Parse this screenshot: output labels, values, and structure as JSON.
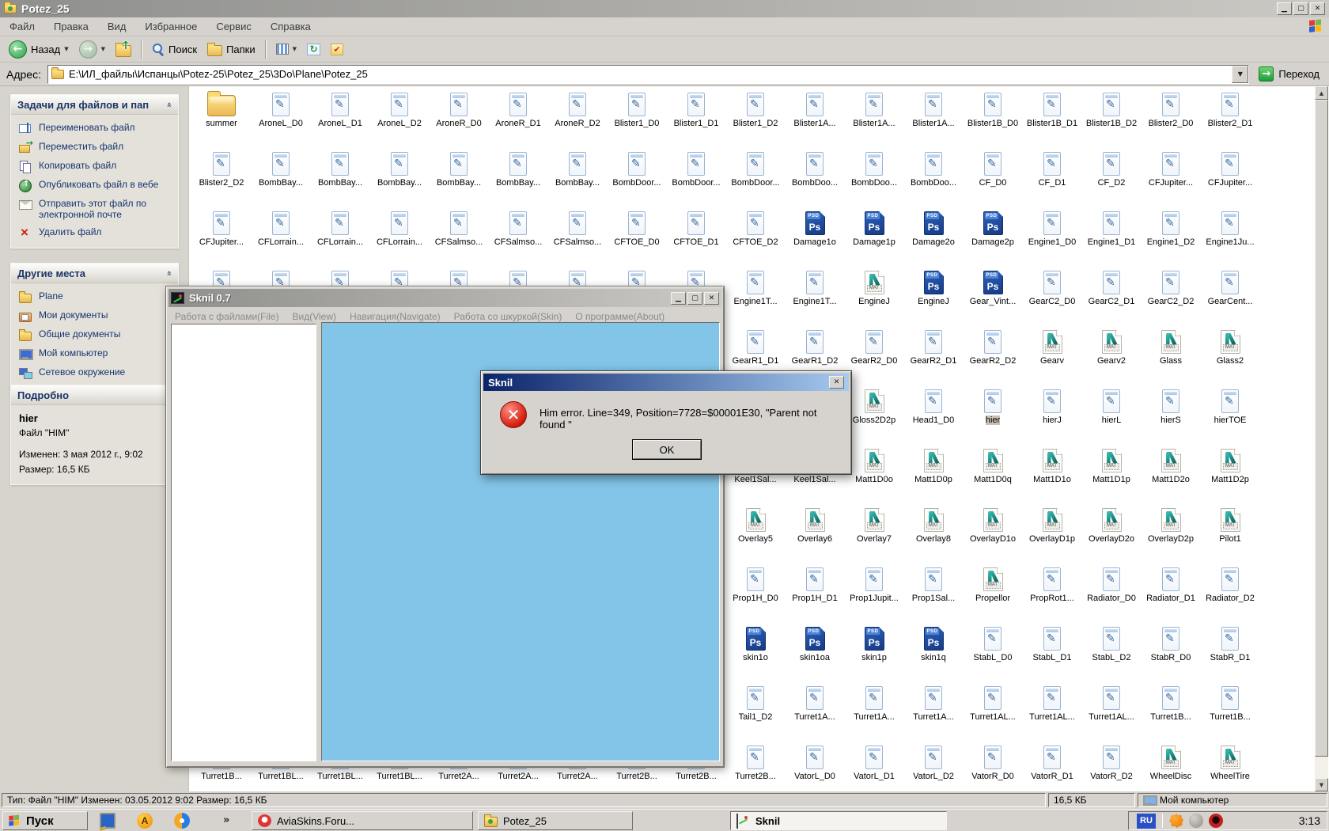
{
  "colors": {
    "classic_face": "#d6d3ce",
    "canvas_blue": "#83c5e9",
    "title_active_left": "#0a246a",
    "title_active_right": "#a6caf0",
    "title_inactive_left": "#8f8f8d",
    "title_inactive_right": "#cbc9c4",
    "selection_unfocused": "#c9c2b4",
    "error_red": "#d11c0c"
  },
  "explorer": {
    "title": "Potez_25",
    "menu": [
      "Файл",
      "Правка",
      "Вид",
      "Избранное",
      "Сервис",
      "Справка"
    ],
    "toolbar": {
      "back_label": "Назад",
      "search_label": "Поиск",
      "folders_label": "Папки"
    },
    "address_label": "Адрес:",
    "address_value": "E:\\ИЛ_файлы\\Испанцы\\Potez-25\\Potez_25\\3Do\\Plane\\Potez_25",
    "go_label": "Переход",
    "tasks_panel": {
      "title": "Задачи для файлов и пап",
      "items": [
        {
          "icon": "rename-icon",
          "label": "Переименовать файл"
        },
        {
          "icon": "move-icon",
          "label": "Переместить файл"
        },
        {
          "icon": "copy-icon",
          "label": "Копировать файл"
        },
        {
          "icon": "publish-icon",
          "label": "Опубликовать файл в вебе"
        },
        {
          "icon": "email-icon",
          "label": "Отправить этот файл по электронной почте"
        },
        {
          "icon": "delete-icon",
          "label": "Удалить файл"
        }
      ]
    },
    "places_panel": {
      "title": "Другие места",
      "items": [
        {
          "icon": "folder-icon-s",
          "label": "Plane"
        },
        {
          "icon": "my-documents-icon",
          "label": "Мои документы"
        },
        {
          "icon": "folder-icon-s",
          "label": "Общие документы"
        },
        {
          "icon": "my-computer-icon",
          "label": "Мой компьютер"
        },
        {
          "icon": "network-icon",
          "label": "Сетевое окружение"
        }
      ]
    },
    "details_panel": {
      "title": "Подробно",
      "name": "hier",
      "type_line": "Файл \"HIM\"",
      "modified_line": "Изменен: 3 мая 2012 г., 9:02",
      "size_line": "Размер: 16,5 КБ"
    },
    "status_left": "Тип: Файл \"HIM\" Изменен: 03.05.2012 9:02 Размер: 16,5 КБ",
    "status_size": "16,5 КБ",
    "status_zone": "Мой компьютер"
  },
  "files": [
    {
      "row": 1,
      "col": 1,
      "type": "folder",
      "label": "summer"
    },
    {
      "row": 1,
      "col": 2,
      "type": "doc",
      "label": "AroneL_D0"
    },
    {
      "row": 1,
      "col": 3,
      "type": "doc",
      "label": "AroneL_D1"
    },
    {
      "row": 1,
      "col": 4,
      "type": "doc",
      "label": "AroneL_D2"
    },
    {
      "row": 1,
      "col": 5,
      "type": "doc",
      "label": "AroneR_D0"
    },
    {
      "row": 1,
      "col": 6,
      "type": "doc",
      "label": "AroneR_D1"
    },
    {
      "row": 1,
      "col": 7,
      "type": "doc",
      "label": "AroneR_D2"
    },
    {
      "row": 1,
      "col": 8,
      "type": "doc",
      "label": "Blister1_D0"
    },
    {
      "row": 1,
      "col": 9,
      "type": "doc",
      "label": "Blister1_D1"
    },
    {
      "row": 1,
      "col": 10,
      "type": "doc",
      "label": "Blister1_D2"
    },
    {
      "row": 1,
      "col": 11,
      "type": "doc",
      "label": "Blister1A..."
    },
    {
      "row": 1,
      "col": 12,
      "type": "doc",
      "label": "Blister1A..."
    },
    {
      "row": 1,
      "col": 13,
      "type": "doc",
      "label": "Blister1A..."
    },
    {
      "row": 1,
      "col": 14,
      "type": "doc",
      "label": "Blister1B_D0"
    },
    {
      "row": 1,
      "col": 15,
      "type": "doc",
      "label": "Blister1B_D1"
    },
    {
      "row": 1,
      "col": 16,
      "type": "doc",
      "label": "Blister1B_D2"
    },
    {
      "row": 1,
      "col": 17,
      "type": "doc",
      "label": "Blister2_D0"
    },
    {
      "row": 1,
      "col": 18,
      "type": "doc",
      "label": "Blister2_D1"
    },
    {
      "row": 2,
      "col": 1,
      "type": "doc",
      "label": "Blister2_D2"
    },
    {
      "row": 2,
      "col": 2,
      "type": "doc",
      "label": "BombBay..."
    },
    {
      "row": 2,
      "col": 3,
      "type": "doc",
      "label": "BombBay..."
    },
    {
      "row": 2,
      "col": 4,
      "type": "doc",
      "label": "BombBay..."
    },
    {
      "row": 2,
      "col": 5,
      "type": "doc",
      "label": "BombBay..."
    },
    {
      "row": 2,
      "col": 6,
      "type": "doc",
      "label": "BombBay..."
    },
    {
      "row": 2,
      "col": 7,
      "type": "doc",
      "label": "BombBay..."
    },
    {
      "row": 2,
      "col": 8,
      "type": "doc",
      "label": "BombDoor..."
    },
    {
      "row": 2,
      "col": 9,
      "type": "doc",
      "label": "BombDoor..."
    },
    {
      "row": 2,
      "col": 10,
      "type": "doc",
      "label": "BombDoor..."
    },
    {
      "row": 2,
      "col": 11,
      "type": "doc",
      "label": "BombDoo..."
    },
    {
      "row": 2,
      "col": 12,
      "type": "doc",
      "label": "BombDoo..."
    },
    {
      "row": 2,
      "col": 13,
      "type": "doc",
      "label": "BombDoo..."
    },
    {
      "row": 2,
      "col": 14,
      "type": "doc",
      "label": "CF_D0"
    },
    {
      "row": 2,
      "col": 15,
      "type": "doc",
      "label": "CF_D1"
    },
    {
      "row": 2,
      "col": 16,
      "type": "doc",
      "label": "CF_D2"
    },
    {
      "row": 2,
      "col": 17,
      "type": "doc",
      "label": "CFJupiter..."
    },
    {
      "row": 2,
      "col": 18,
      "type": "doc",
      "label": "CFJupiter..."
    },
    {
      "row": 3,
      "col": 1,
      "type": "doc",
      "label": "CFJupiter..."
    },
    {
      "row": 3,
      "col": 2,
      "type": "doc",
      "label": "CFLorrain..."
    },
    {
      "row": 3,
      "col": 3,
      "type": "doc",
      "label": "CFLorrain..."
    },
    {
      "row": 3,
      "col": 4,
      "type": "doc",
      "label": "CFLorrain..."
    },
    {
      "row": 3,
      "col": 5,
      "type": "doc",
      "label": "CFSalmso..."
    },
    {
      "row": 3,
      "col": 6,
      "type": "doc",
      "label": "CFSalmso..."
    },
    {
      "row": 3,
      "col": 7,
      "type": "doc",
      "label": "CFSalmso..."
    },
    {
      "row": 3,
      "col": 8,
      "type": "doc",
      "label": "CFTOE_D0"
    },
    {
      "row": 3,
      "col": 9,
      "type": "doc",
      "label": "CFTOE_D1"
    },
    {
      "row": 3,
      "col": 10,
      "type": "doc",
      "label": "CFTOE_D2"
    },
    {
      "row": 3,
      "col": 11,
      "type": "psd",
      "label": "Damage1o"
    },
    {
      "row": 3,
      "col": 12,
      "type": "psd",
      "label": "Damage1p"
    },
    {
      "row": 3,
      "col": 13,
      "type": "psd",
      "label": "Damage2o"
    },
    {
      "row": 3,
      "col": 14,
      "type": "psd",
      "label": "Damage2p"
    },
    {
      "row": 3,
      "col": 15,
      "type": "doc",
      "label": "Engine1_D0"
    },
    {
      "row": 3,
      "col": 16,
      "type": "doc",
      "label": "Engine1_D1"
    },
    {
      "row": 3,
      "col": 17,
      "type": "doc",
      "label": "Engine1_D2"
    },
    {
      "row": 3,
      "col": 18,
      "type": "doc",
      "label": "Engine1Ju..."
    },
    {
      "row": 4,
      "col": 1,
      "type": "doc",
      "label": ""
    },
    {
      "row": 4,
      "col": 2,
      "type": "doc",
      "label": ""
    },
    {
      "row": 4,
      "col": 3,
      "type": "doc",
      "label": ""
    },
    {
      "row": 4,
      "col": 4,
      "type": "doc",
      "label": ""
    },
    {
      "row": 4,
      "col": 5,
      "type": "doc",
      "label": ""
    },
    {
      "row": 4,
      "col": 6,
      "type": "doc",
      "label": ""
    },
    {
      "row": 4,
      "col": 7,
      "type": "doc",
      "label": ""
    },
    {
      "row": 4,
      "col": 8,
      "type": "doc",
      "label": ""
    },
    {
      "row": 4,
      "col": 9,
      "type": "doc",
      "label": ""
    },
    {
      "row": 4,
      "col": 10,
      "type": "doc",
      "label": "Engine1T..."
    },
    {
      "row": 4,
      "col": 11,
      "type": "doc",
      "label": "Engine1T..."
    },
    {
      "row": 4,
      "col": 12,
      "type": "mat",
      "label": "EngineJ"
    },
    {
      "row": 4,
      "col": 13,
      "type": "psd",
      "label": "EngineJ"
    },
    {
      "row": 4,
      "col": 14,
      "type": "psd",
      "label": "Gear_Vint..."
    },
    {
      "row": 4,
      "col": 15,
      "type": "doc",
      "label": "GearC2_D0"
    },
    {
      "row": 4,
      "col": 16,
      "type": "doc",
      "label": "GearC2_D1"
    },
    {
      "row": 4,
      "col": 17,
      "type": "doc",
      "label": "GearC2_D2"
    },
    {
      "row": 4,
      "col": 18,
      "type": "doc",
      "label": "GearCent..."
    },
    {
      "row": 5,
      "col": 10,
      "type": "doc",
      "label": "GearR1_D1"
    },
    {
      "row": 5,
      "col": 11,
      "type": "doc",
      "label": "GearR1_D2"
    },
    {
      "row": 5,
      "col": 12,
      "type": "doc",
      "label": "GearR2_D0"
    },
    {
      "row": 5,
      "col": 13,
      "type": "doc",
      "label": "GearR2_D1"
    },
    {
      "row": 5,
      "col": 14,
      "type": "doc",
      "label": "GearR2_D2"
    },
    {
      "row": 5,
      "col": 15,
      "type": "mat",
      "label": "Gearv"
    },
    {
      "row": 5,
      "col": 16,
      "type": "mat",
      "label": "Gearv2"
    },
    {
      "row": 5,
      "col": 17,
      "type": "mat",
      "label": "Glass"
    },
    {
      "row": 5,
      "col": 18,
      "type": "mat",
      "label": "Glass2"
    },
    {
      "row": 6,
      "col": 12,
      "type": "mat",
      "label": "Gloss2D2p"
    },
    {
      "row": 6,
      "col": 13,
      "type": "doc",
      "label": "Head1_D0"
    },
    {
      "row": 6,
      "col": 14,
      "type": "doc",
      "label": "hier",
      "selected": true
    },
    {
      "row": 6,
      "col": 15,
      "type": "doc",
      "label": "hierJ"
    },
    {
      "row": 6,
      "col": 16,
      "type": "doc",
      "label": "hierL"
    },
    {
      "row": 6,
      "col": 17,
      "type": "doc",
      "label": "hierS"
    },
    {
      "row": 6,
      "col": 18,
      "type": "doc",
      "label": "hierTOE"
    },
    {
      "row": 7,
      "col": 10,
      "type": "mat",
      "label": "Keel1Sal..."
    },
    {
      "row": 7,
      "col": 11,
      "type": "mat",
      "label": "Keel1Sal..."
    },
    {
      "row": 7,
      "col": 12,
      "type": "mat",
      "label": "Matt1D0o"
    },
    {
      "row": 7,
      "col": 13,
      "type": "mat",
      "label": "Matt1D0p"
    },
    {
      "row": 7,
      "col": 14,
      "type": "mat",
      "label": "Matt1D0q"
    },
    {
      "row": 7,
      "col": 15,
      "type": "mat",
      "label": "Matt1D1o"
    },
    {
      "row": 7,
      "col": 16,
      "type": "mat",
      "label": "Matt1D1p"
    },
    {
      "row": 7,
      "col": 17,
      "type": "mat",
      "label": "Matt1D2o"
    },
    {
      "row": 7,
      "col": 18,
      "type": "mat",
      "label": "Matt1D2p"
    },
    {
      "row": 8,
      "col": 10,
      "type": "mat",
      "label": "Overlay5"
    },
    {
      "row": 8,
      "col": 11,
      "type": "mat",
      "label": "Overlay6"
    },
    {
      "row": 8,
      "col": 12,
      "type": "mat",
      "label": "Overlay7"
    },
    {
      "row": 8,
      "col": 13,
      "type": "mat",
      "label": "Overlay8"
    },
    {
      "row": 8,
      "col": 14,
      "type": "mat",
      "label": "OverlayD1o"
    },
    {
      "row": 8,
      "col": 15,
      "type": "mat",
      "label": "OverlayD1p"
    },
    {
      "row": 8,
      "col": 16,
      "type": "mat",
      "label": "OverlayD2o"
    },
    {
      "row": 8,
      "col": 17,
      "type": "mat",
      "label": "OverlayD2p"
    },
    {
      "row": 8,
      "col": 18,
      "type": "mat",
      "label": "Pilot1"
    },
    {
      "row": 9,
      "col": 10,
      "type": "doc",
      "label": "Prop1H_D0"
    },
    {
      "row": 9,
      "col": 11,
      "type": "doc",
      "label": "Prop1H_D1"
    },
    {
      "row": 9,
      "col": 12,
      "type": "doc",
      "label": "Prop1Jupit..."
    },
    {
      "row": 9,
      "col": 13,
      "type": "doc",
      "label": "Prop1Sal..."
    },
    {
      "row": 9,
      "col": 14,
      "type": "mat",
      "label": "Propellor"
    },
    {
      "row": 9,
      "col": 15,
      "type": "doc",
      "label": "PropRot1..."
    },
    {
      "row": 9,
      "col": 16,
      "type": "doc",
      "label": "Radiator_D0"
    },
    {
      "row": 9,
      "col": 17,
      "type": "doc",
      "label": "Radiator_D1"
    },
    {
      "row": 9,
      "col": 18,
      "type": "doc",
      "label": "Radiator_D2"
    },
    {
      "row": 10,
      "col": 10,
      "type": "psd",
      "label": "skin1o"
    },
    {
      "row": 10,
      "col": 11,
      "type": "psd",
      "label": "skin1oa"
    },
    {
      "row": 10,
      "col": 12,
      "type": "psd",
      "label": "skin1p"
    },
    {
      "row": 10,
      "col": 13,
      "type": "psd",
      "label": "skin1q"
    },
    {
      "row": 10,
      "col": 14,
      "type": "doc",
      "label": "StabL_D0"
    },
    {
      "row": 10,
      "col": 15,
      "type": "doc",
      "label": "StabL_D1"
    },
    {
      "row": 10,
      "col": 16,
      "type": "doc",
      "label": "StabL_D2"
    },
    {
      "row": 10,
      "col": 17,
      "type": "doc",
      "label": "StabR_D0"
    },
    {
      "row": 10,
      "col": 18,
      "type": "doc",
      "label": "StabR_D1"
    },
    {
      "row": 11,
      "col": 10,
      "type": "doc",
      "label": "Tail1_D2"
    },
    {
      "row": 11,
      "col": 11,
      "type": "doc",
      "label": "Turret1A..."
    },
    {
      "row": 11,
      "col": 12,
      "type": "doc",
      "label": "Turret1A..."
    },
    {
      "row": 11,
      "col": 13,
      "type": "doc",
      "label": "Turret1A..."
    },
    {
      "row": 11,
      "col": 14,
      "type": "doc",
      "label": "Turret1AL..."
    },
    {
      "row": 11,
      "col": 15,
      "type": "doc",
      "label": "Turret1AL..."
    },
    {
      "row": 11,
      "col": 16,
      "type": "doc",
      "label": "Turret1AL..."
    },
    {
      "row": 11,
      "col": 17,
      "type": "doc",
      "label": "Turret1B..."
    },
    {
      "row": 11,
      "col": 18,
      "type": "doc",
      "label": "Turret1B..."
    },
    {
      "row": 12,
      "col": 1,
      "type": "doc",
      "label": "Turret1B..."
    },
    {
      "row": 12,
      "col": 2,
      "type": "doc",
      "label": "Turret1BL..."
    },
    {
      "row": 12,
      "col": 3,
      "type": "doc",
      "label": "Turret1BL..."
    },
    {
      "row": 12,
      "col": 4,
      "type": "doc",
      "label": "Turret1BL..."
    },
    {
      "row": 12,
      "col": 5,
      "type": "doc",
      "label": "Turret2A..."
    },
    {
      "row": 12,
      "col": 6,
      "type": "doc",
      "label": "Turret2A..."
    },
    {
      "row": 12,
      "col": 7,
      "type": "doc",
      "label": "Turret2A..."
    },
    {
      "row": 12,
      "col": 8,
      "type": "doc",
      "label": "Turret2B..."
    },
    {
      "row": 12,
      "col": 9,
      "type": "doc",
      "label": "Turret2B..."
    },
    {
      "row": 12,
      "col": 10,
      "type": "doc",
      "label": "Turret2B..."
    },
    {
      "row": 12,
      "col": 11,
      "type": "doc",
      "label": "VatorL_D0"
    },
    {
      "row": 12,
      "col": 12,
      "type": "doc",
      "label": "VatorL_D1"
    },
    {
      "row": 12,
      "col": 13,
      "type": "doc",
      "label": "VatorL_D2"
    },
    {
      "row": 12,
      "col": 14,
      "type": "doc",
      "label": "VatorR_D0"
    },
    {
      "row": 12,
      "col": 15,
      "type": "doc",
      "label": "VatorR_D1"
    },
    {
      "row": 12,
      "col": 16,
      "type": "doc",
      "label": "VatorR_D2"
    },
    {
      "row": 12,
      "col": 17,
      "type": "mat",
      "label": "WheelDisc"
    },
    {
      "row": 12,
      "col": 18,
      "type": "mat",
      "label": "WheelTire"
    }
  ],
  "sknil": {
    "title": "Sknil 0.7",
    "menu": [
      "Работа с файлами(File)",
      "Вид(View)",
      "Навигация(Navigate)",
      "Работа со шкуркой(Skin)",
      "О программе(About)"
    ]
  },
  "dialog": {
    "title": "Sknil",
    "message": "Him error. Line=349, Position=7728=$00001E30, \"Parent not found \"",
    "ok_label": "OK"
  },
  "taskbar": {
    "start_label": "Пуск",
    "quick_launch": [
      {
        "icon": "show-desktop-icon"
      },
      {
        "icon": "orange-app-icon",
        "letter": "A"
      },
      {
        "icon": "media-player-icon"
      }
    ],
    "overflow_chevron": "»",
    "tasks": [
      {
        "label": "AviaSkins.Foru...",
        "icon": "opera-icon"
      },
      {
        "label": "Potez_25",
        "icon": "folder-icon"
      },
      {
        "label": "Sknil",
        "icon": "sknil-icon",
        "active": true
      }
    ],
    "tray_lang": "RU",
    "tray_icons": [
      {
        "icon": "avast-tray-icon"
      },
      {
        "icon": "volume-tray-icon"
      },
      {
        "icon": "opera-tray-icon"
      }
    ],
    "clock": "3:13"
  }
}
